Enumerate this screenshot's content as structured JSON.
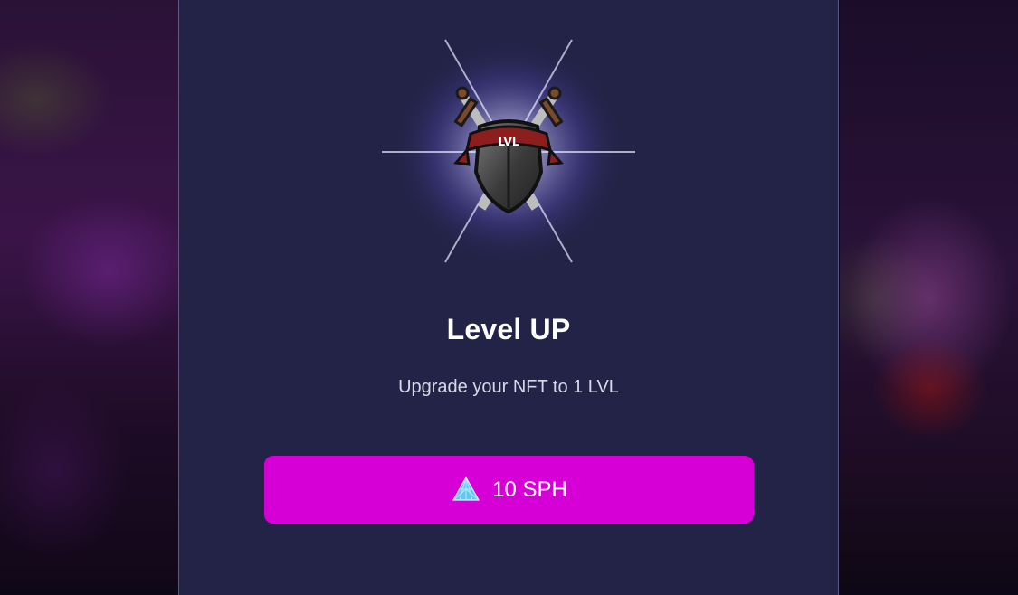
{
  "modal": {
    "badge_icon": "level-up-shield-icon",
    "badge_text": "LVL",
    "title": "Level UP",
    "subtitle": "Upgrade your NFT to 1 LVL",
    "button": {
      "icon": "sapphire-gem-icon",
      "label": "10 SPH",
      "color": "#d600d6"
    }
  },
  "colors": {
    "modal_background": "#232348",
    "title_text": "#ffffff",
    "subtitle_text": "#d8d8ea"
  }
}
